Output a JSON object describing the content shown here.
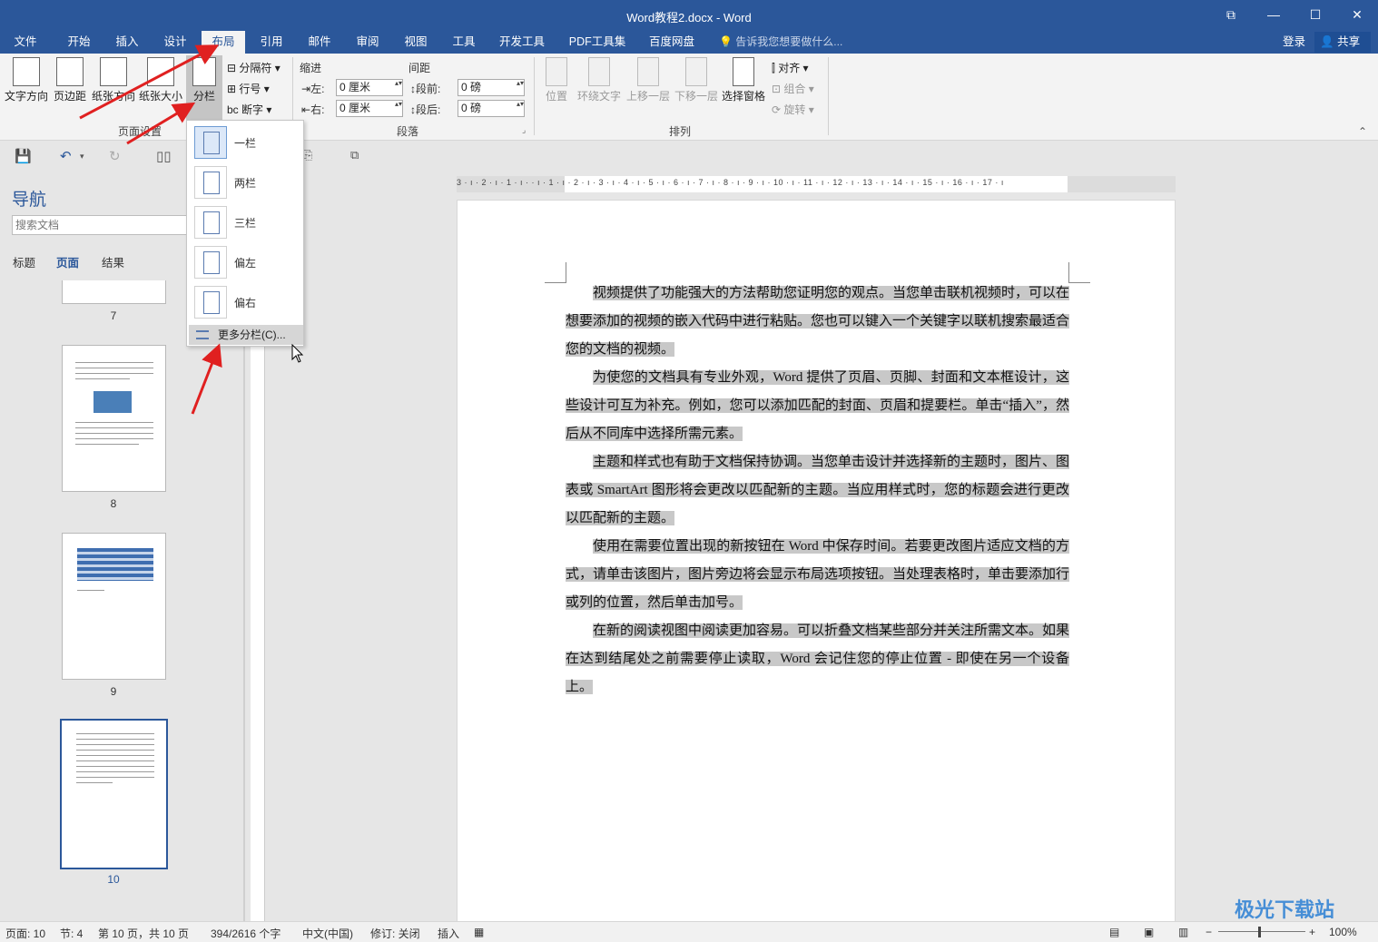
{
  "window": {
    "title": "Word教程2.docx - Word",
    "buttons": {
      "restore_ribbon": "⧉",
      "minimize": "—",
      "maximize": "☐",
      "close": "✕"
    }
  },
  "menu": {
    "tabs": [
      "文件",
      "开始",
      "插入",
      "设计",
      "布局",
      "引用",
      "邮件",
      "审阅",
      "视图",
      "工具",
      "开发工具",
      "PDF工具集",
      "百度网盘"
    ],
    "active_tab": "布局",
    "tell_me": "告诉我您想要做什么...",
    "login": "登录",
    "share": "共享"
  },
  "ribbon": {
    "page_setup": {
      "group_name": "页面设置",
      "text_direction": "文字方向",
      "margins": "页边距",
      "orientation": "纸张方向",
      "size": "纸张大小",
      "columns": "分栏",
      "breaks": "分隔符",
      "line_numbers": "行号",
      "hyphenation": "断字"
    },
    "paragraph": {
      "group_name": "段落",
      "indent_label": "缩进",
      "spacing_label": "间距",
      "left_label": "左:",
      "right_label": "右:",
      "left_value": "0 厘米",
      "right_value": "0 厘米",
      "before_label": "段前:",
      "after_label": "段后:",
      "before_value": "0 磅",
      "after_value": "0 磅"
    },
    "arrange": {
      "group_name": "排列",
      "position": "位置",
      "wrap_text": "环绕文字",
      "bring_forward": "上移一层",
      "send_backward": "下移一层",
      "selection_pane": "选择窗格",
      "align": "对齐",
      "group": "组合",
      "rotate": "旋转"
    }
  },
  "columns_menu": {
    "items": [
      "一栏",
      "两栏",
      "三栏",
      "偏左",
      "偏右"
    ],
    "more": "更多分栏(C)..."
  },
  "nav": {
    "title": "导航",
    "search_placeholder": "搜索文档",
    "tabs": [
      "标题",
      "页面",
      "结果"
    ],
    "active_tab": "页面",
    "pages": [
      "7",
      "8",
      "9",
      "10"
    ],
    "selected_page": "10"
  },
  "ruler": {
    "numbers": "3 · ı · 2 · ı · 1 · ı ·     · ı · 1 · ı · 2 · ı · 3 · ı · 4 · ı · 5 · ı · 6 · ı · 7 · ı · 8 · ı · 9 · ı · 10 · ı · 11 · ı · 12 · ı · 13 · ı · 14 · ı · 15 · ı · 16 · ı · 17 · ı"
  },
  "document": {
    "paragraphs": [
      "视频提供了功能强大的方法帮助您证明您的观点。当您单击联机视频时，可以在想要添加的视频的嵌入代码中进行粘贴。您也可以键入一个关键字以联机搜索最适合您的文档的视频。",
      "为使您的文档具有专业外观，Word 提供了页眉、页脚、封面和文本框设计，这些设计可互为补充。例如，您可以添加匹配的封面、页眉和提要栏。单击“插入”，然后从不同库中选择所需元素。",
      "主题和样式也有助于文档保持协调。当您单击设计并选择新的主题时，图片、图表或 SmartArt 图形将会更改以匹配新的主题。当应用样式时，您的标题会进行更改以匹配新的主题。",
      "使用在需要位置出现的新按钮在 Word 中保存时间。若要更改图片适应文档的方式，请单击该图片，图片旁边将会显示布局选项按钮。当处理表格时，单击要添加行或列的位置，然后单击加号。",
      "在新的阅读视图中阅读更加容易。可以折叠文档某些部分并关注所需文本。如果在达到结尾处之前需要停止读取，Word 会记住您的停止位置 - 即使在另一个设备上。"
    ]
  },
  "status": {
    "page": "页面: 10",
    "section": "节: 4",
    "page_of": "第 10 页，共 10 页",
    "words": "394/2616 个字",
    "language": "中文(中国)",
    "track_changes": "修订: 关闭",
    "insert_mode": "插入",
    "zoom": "100%"
  },
  "colors": {
    "brand": "#2b579a",
    "selection": "#c8c8c8",
    "arrow": "#e02020"
  },
  "watermark": "极光下载站"
}
